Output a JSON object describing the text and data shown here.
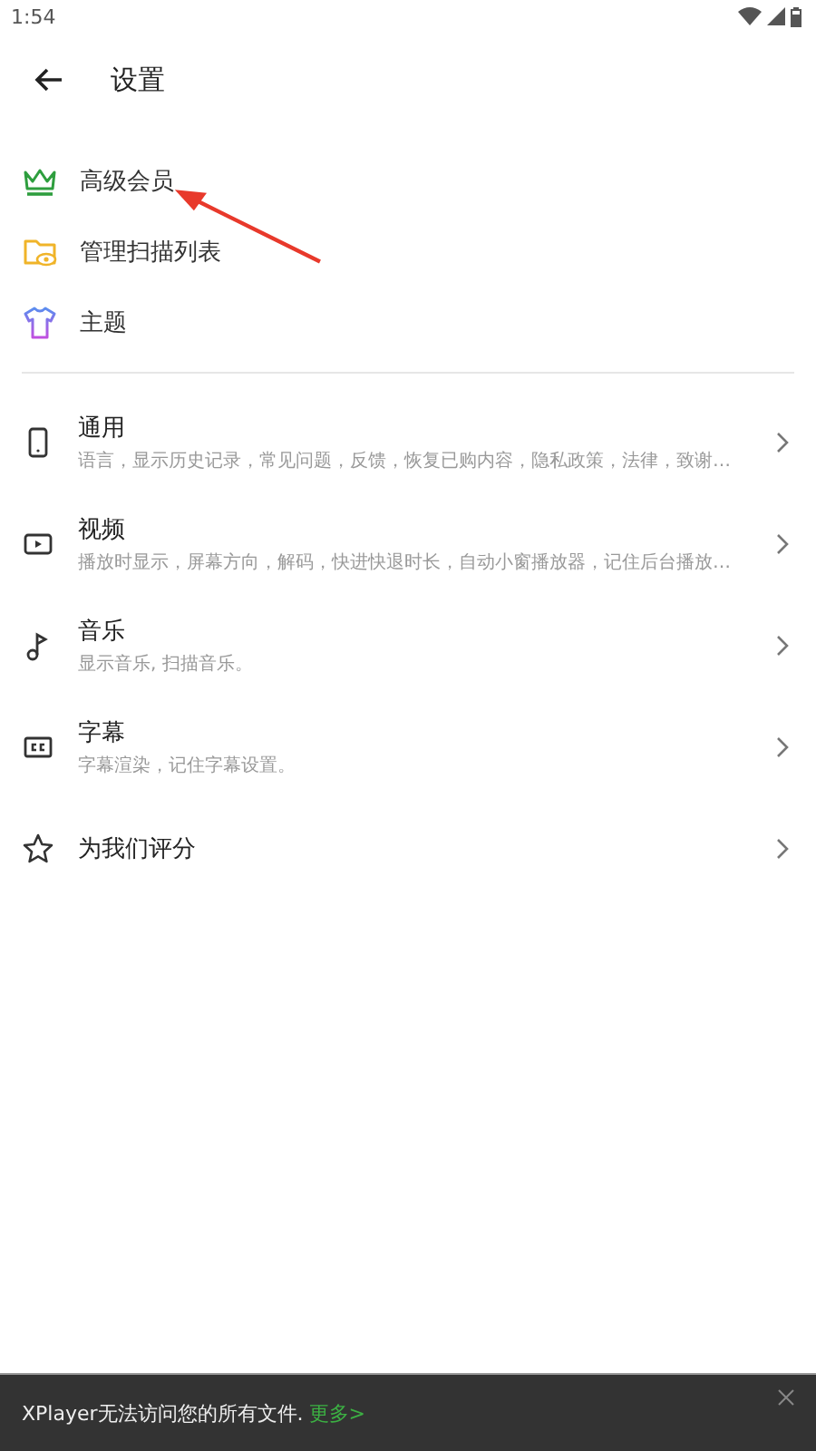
{
  "status_bar": {
    "time": "1:54"
  },
  "header": {
    "title": "设置"
  },
  "quick_items": [
    {
      "label": "高级会员"
    },
    {
      "label": "管理扫描列表"
    },
    {
      "label": "主题"
    }
  ],
  "settings": [
    {
      "title": "通用",
      "subtitle": "语言，显示历史记录，常见问题，反馈，恢复已购内容，隐私政策，法律，致谢…"
    },
    {
      "title": "视频",
      "subtitle": "播放时显示，屏幕方向，解码，快进快退时长，自动小窗播放器，记住后台播放…"
    },
    {
      "title": "音乐",
      "subtitle": "显示音乐, 扫描音乐。"
    },
    {
      "title": "字幕",
      "subtitle": "字幕渲染，记住字幕设置。"
    },
    {
      "title": "为我们评分"
    }
  ],
  "banner": {
    "message": "XPlayer无法访问您的所有文件.",
    "link": "更多>"
  }
}
